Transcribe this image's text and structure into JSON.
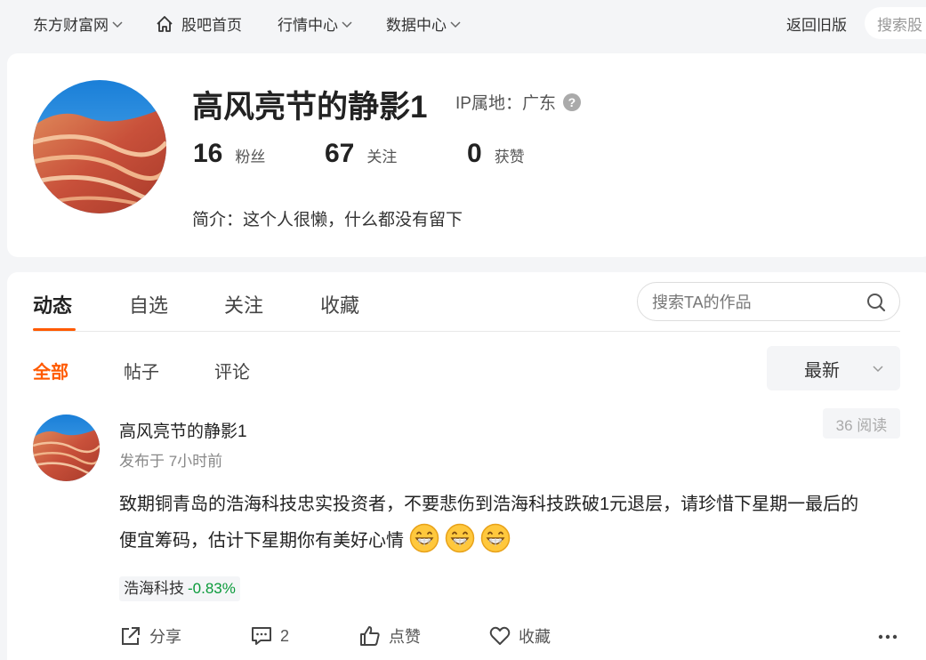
{
  "topnav": {
    "site": "东方财富网",
    "home": "股吧首页",
    "market": "行情中心",
    "data": "数据中心",
    "old_version": "返回旧版",
    "search_placeholder": "搜索股"
  },
  "profile": {
    "username": "高风亮节的静影1",
    "ip_label": "IP属地：广东",
    "stats": [
      {
        "value": "16",
        "label": "粉丝"
      },
      {
        "value": "67",
        "label": "关注"
      },
      {
        "value": "0",
        "label": "获赞"
      }
    ],
    "bio": "简介：这个人很懒，什么都没有留下"
  },
  "tabs": [
    "动态",
    "自选",
    "关注",
    "收藏"
  ],
  "ta_search_placeholder": "搜索TA的作品",
  "subtabs": [
    "全部",
    "帖子",
    "评论"
  ],
  "sort_label": "最新",
  "post": {
    "author": "高风亮节的静影1",
    "time": "发布于 7小时前",
    "reads": "36 阅读",
    "body_line1": "致期铜青岛的浩海科技忠实投资者，不要悲伤到浩海科技跌破1元退层，请珍惜下星期一最后的",
    "body_line2": "便宜筹码，估计下星期你有美好心情",
    "stock_name": "浩海科技",
    "stock_change": "-0.83%",
    "actions": {
      "share": "分享",
      "comment_count": "2",
      "like": "点赞",
      "favorite": "收藏"
    }
  },
  "colors": {
    "accent": "#ff5a00",
    "down_green": "#0a9a3a"
  }
}
